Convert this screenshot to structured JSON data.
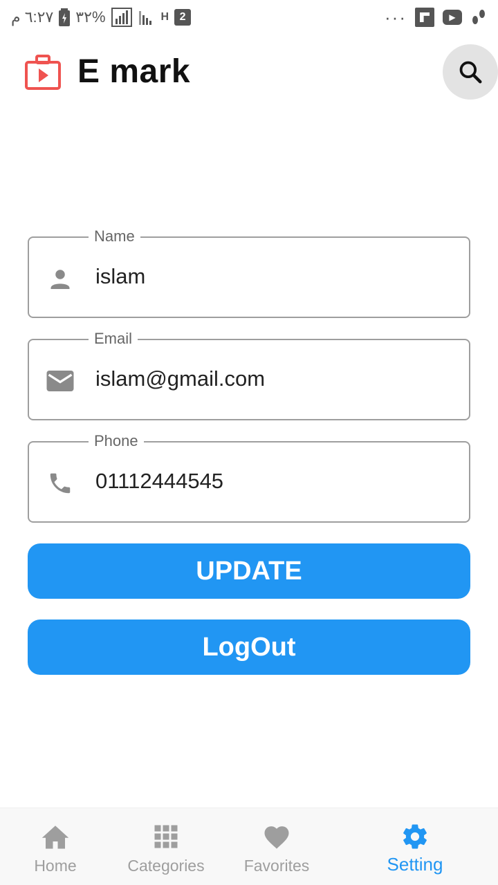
{
  "status_bar": {
    "time": "٦:٢٧ م",
    "battery": "٣٢%",
    "sim_badge": "2",
    "network": "H",
    "dots": "···"
  },
  "header": {
    "title": "E mark"
  },
  "form": {
    "fields": [
      {
        "label": "Name",
        "value": "islam",
        "icon": "person-icon"
      },
      {
        "label": "Email",
        "value": "islam@gmail.com",
        "icon": "mail-icon"
      },
      {
        "label": "Phone",
        "value": "01112444545",
        "icon": "phone-icon"
      }
    ],
    "update_label": "UPDATE",
    "logout_label": "LogOut"
  },
  "bottom_nav": {
    "items": [
      {
        "label": "Home",
        "icon": "home-icon",
        "active": false
      },
      {
        "label": "Categories",
        "icon": "grid-icon",
        "active": false
      },
      {
        "label": "Favorites",
        "icon": "heart-icon",
        "active": false
      },
      {
        "label": "Setting",
        "icon": "gear-icon",
        "active": true
      }
    ]
  },
  "colors": {
    "accent": "#2196f3",
    "logo": "#ef5350",
    "icon_gray": "#8a8a8a"
  }
}
